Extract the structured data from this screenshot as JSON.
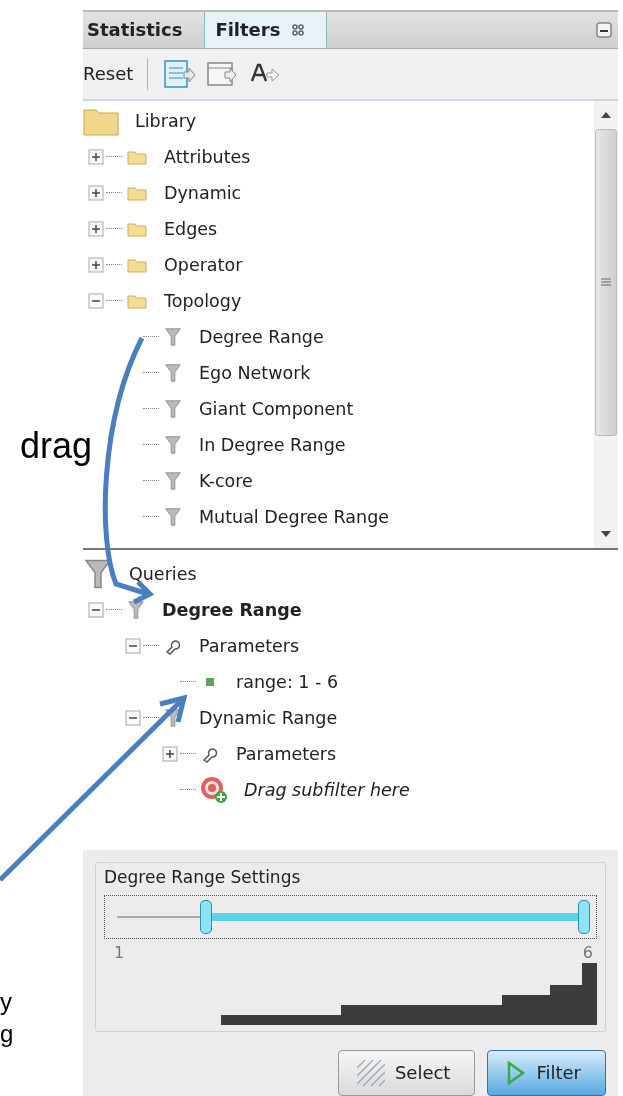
{
  "annotations": [
    {
      "text": "drag"
    },
    {
      "text": "y"
    },
    {
      "text": "g"
    }
  ],
  "tabs": [
    {
      "label": "Statistics",
      "selected": false,
      "closable": false
    },
    {
      "label": "Filters",
      "selected": true,
      "closable": true
    }
  ],
  "toolbar": {
    "reset": "Reset"
  },
  "library": [
    {
      "label": "Library",
      "kind": "folder",
      "children": [
        {
          "label": "Attributes",
          "kind": "folder",
          "expanded": false
        },
        {
          "label": "Dynamic",
          "kind": "folder",
          "expanded": false
        },
        {
          "label": "Edges",
          "kind": "folder",
          "expanded": false
        },
        {
          "label": "Operator",
          "kind": "folder",
          "expanded": false
        },
        {
          "label": "Topology",
          "kind": "folder",
          "expanded": true,
          "children": [
            {
              "label": "Degree Range",
              "kind": "filter"
            },
            {
              "label": "Ego Network",
              "kind": "filter"
            },
            {
              "label": "Giant Component",
              "kind": "filter"
            },
            {
              "label": "In Degree Range",
              "kind": "filter"
            },
            {
              "label": "K-core",
              "kind": "filter"
            },
            {
              "label": "Mutual Degree Range",
              "kind": "filter"
            }
          ]
        }
      ]
    }
  ],
  "queries": [
    {
      "label": "Queries",
      "kind": "filter",
      "children": [
        {
          "label": "Degree Range",
          "kind": "query",
          "expanded": true,
          "children": [
            {
              "label": "Parameters",
              "kind": "parameters",
              "expanded": true,
              "children": [
                {
                  "label": "range: 1 - 6",
                  "kind": "value"
                }
              ]
            },
            {
              "label": "Dynamic Range",
              "kind": "filter",
              "expanded": true,
              "children": [
                {
                  "label": "Parameters",
                  "kind": "parameters",
                  "expanded": false
                },
                {
                  "label": "Drag subfilter here",
                  "kind": "drop-target"
                }
              ]
            }
          ]
        }
      ]
    }
  ],
  "settings": {
    "title": "Degree Range Settings",
    "thumbs": [
      {
        "level": 0.19
      },
      {
        "level": 1
      }
    ],
    "min": "1",
    "max": "6"
  },
  "buttons": [
    {
      "label": "Select",
      "kind": "select",
      "default": false
    },
    {
      "label": "Filter",
      "kind": "filter",
      "default": true
    }
  ]
}
